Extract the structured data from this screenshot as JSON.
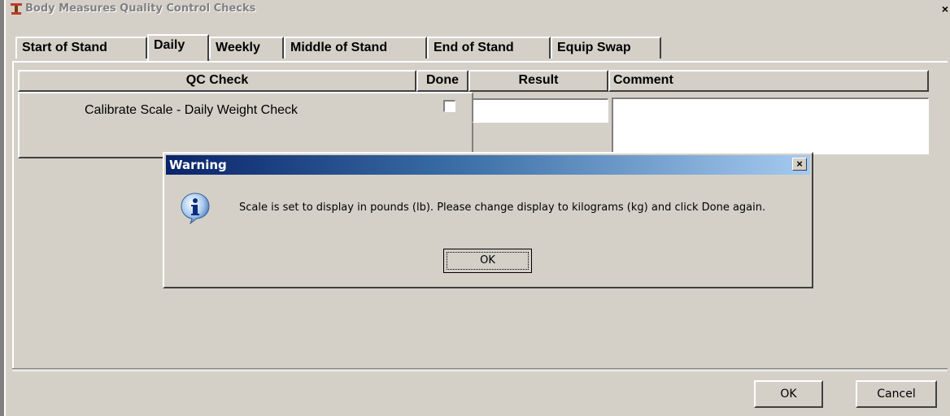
{
  "window": {
    "title": "Body Measures Quality Control Checks",
    "close_glyph": "×",
    "icon": "scale-icon"
  },
  "tabs": [
    {
      "label": "Start of Stand",
      "active": false
    },
    {
      "label": "Daily",
      "active": true
    },
    {
      "label": "Weekly",
      "active": false
    },
    {
      "label": "Middle of Stand",
      "active": false
    },
    {
      "label": "End of Stand",
      "active": false
    },
    {
      "label": "Equip Swap",
      "active": false
    }
  ],
  "table": {
    "headers": {
      "qc_check": "QC Check",
      "done": "Done",
      "result": "Result",
      "comment": "Comment"
    },
    "rows": [
      {
        "qc_check": "Calibrate Scale - Daily Weight Check",
        "done": false,
        "result": "",
        "comment": ""
      }
    ]
  },
  "footer": {
    "ok_label": "OK",
    "cancel_label": "Cancel"
  },
  "dialog": {
    "title": "Warning",
    "close_glyph": "×",
    "icon": "info-icon",
    "message": "Scale is set to display in pounds (lb).  Please change display to kilograms (kg) and click Done again.",
    "ok_label": "OK"
  },
  "colors": {
    "face": "#d4d0c8",
    "dialog_title_start": "#0a246a",
    "dialog_title_end": "#a6caf0"
  }
}
